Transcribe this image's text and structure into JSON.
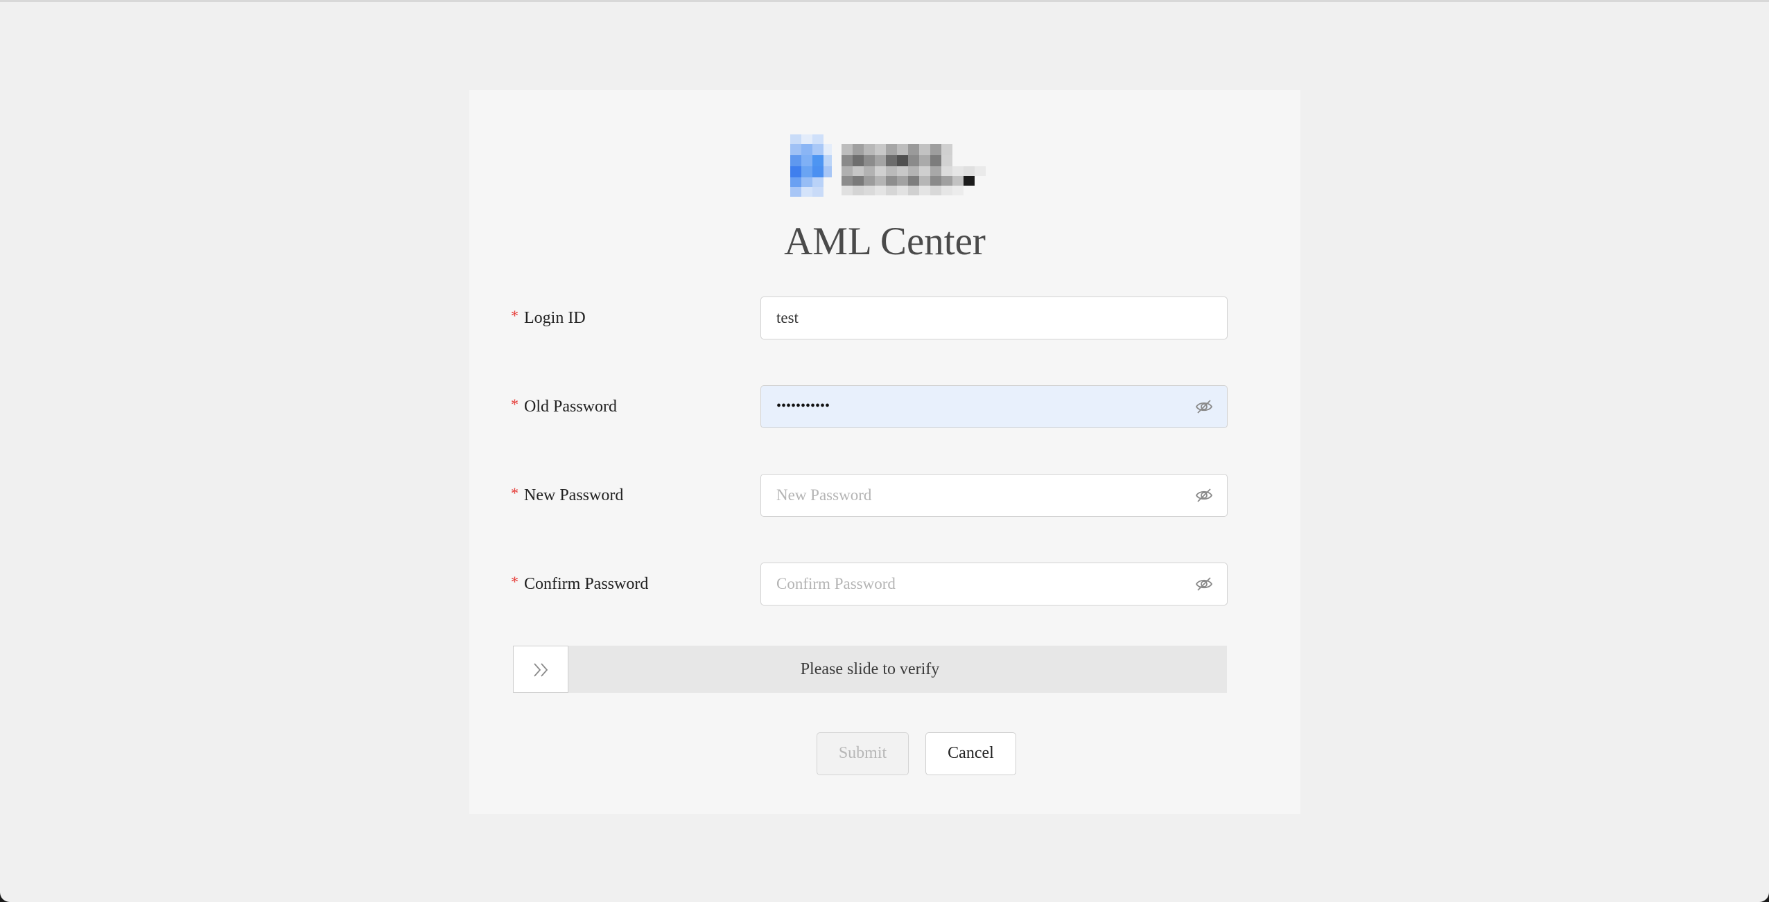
{
  "app": {
    "title": "AML Center"
  },
  "form": {
    "login_id": {
      "label": "Login ID",
      "value": "test",
      "required": true
    },
    "old_password": {
      "label": "Old Password",
      "value": "•••••••••••",
      "required": true
    },
    "new_password": {
      "label": "New Password",
      "placeholder": "New Password",
      "required": true
    },
    "confirm_password": {
      "label": "Confirm Password",
      "placeholder": "Confirm Password",
      "required": true
    },
    "required_marker": "*"
  },
  "slider": {
    "text": "Please slide to verify",
    "handle_icon": "double-chevron-right-icon"
  },
  "actions": {
    "submit_label": "Submit",
    "cancel_label": "Cancel"
  },
  "colors": {
    "required": "#e53935",
    "autofill_bg": "#e8f0fc",
    "logo_blue": "#4a8ef0"
  }
}
